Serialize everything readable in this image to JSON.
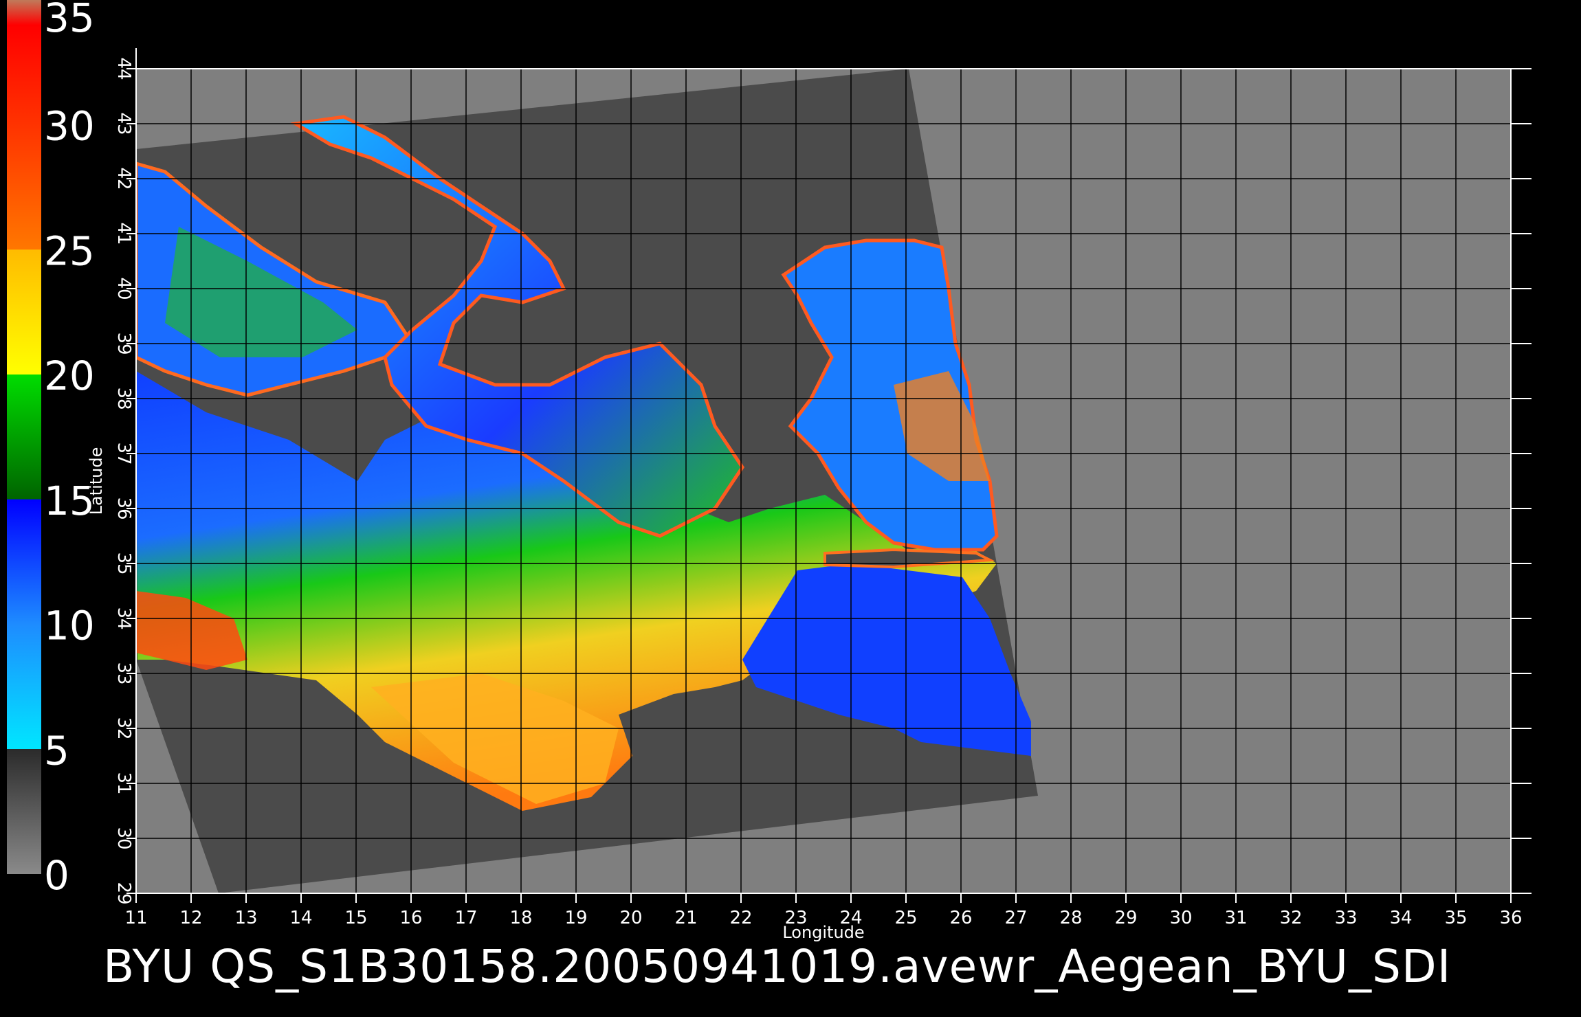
{
  "caption": "BYU  QS_S1B30158.20050941019.avewr_Aegean_BYU_SDI",
  "map": {
    "x_axis_label": "Longitude",
    "y_axis_label": "Latitude",
    "longitudes": [
      11,
      12,
      13,
      14,
      15,
      16,
      17,
      18,
      19,
      20,
      21,
      22,
      23,
      24,
      25,
      26,
      27,
      28,
      29,
      30,
      31,
      32,
      33,
      34,
      35,
      36
    ],
    "latitudes": [
      29,
      30,
      31,
      32,
      33,
      34,
      35,
      36,
      37,
      38,
      39,
      40,
      41,
      42,
      43,
      44
    ],
    "lon_range": [
      11,
      36
    ],
    "lat_range": [
      29,
      44
    ],
    "grid": true
  },
  "colorbar": {
    "ticks": [
      "35",
      "30",
      "25",
      "20",
      "15",
      "10",
      "5",
      "0"
    ],
    "range": [
      0,
      35
    ],
    "stops": [
      {
        "value": 0,
        "color": "#8a8a8a"
      },
      {
        "value": 5,
        "color": "#2b2b2b"
      },
      {
        "value": 5.01,
        "color": "#00e6ff"
      },
      {
        "value": 10,
        "color": "#1e8cff"
      },
      {
        "value": 15,
        "color": "#0000ff"
      },
      {
        "value": 15.01,
        "color": "#006400"
      },
      {
        "value": 20,
        "color": "#00dd00"
      },
      {
        "value": 20.01,
        "color": "#ffff00"
      },
      {
        "value": 25,
        "color": "#ffbb00"
      },
      {
        "value": 25.01,
        "color": "#ff7700"
      },
      {
        "value": 30,
        "color": "#ff3300"
      },
      {
        "value": 34,
        "color": "#ff0000"
      },
      {
        "value": 35,
        "color": "#c07a5a"
      }
    ]
  },
  "colors": {
    "background": "#000000",
    "plot_background": "#7f7f7f",
    "swath": "#4b4b4b",
    "land": "#4b4b4b",
    "grid": "#000000"
  }
}
